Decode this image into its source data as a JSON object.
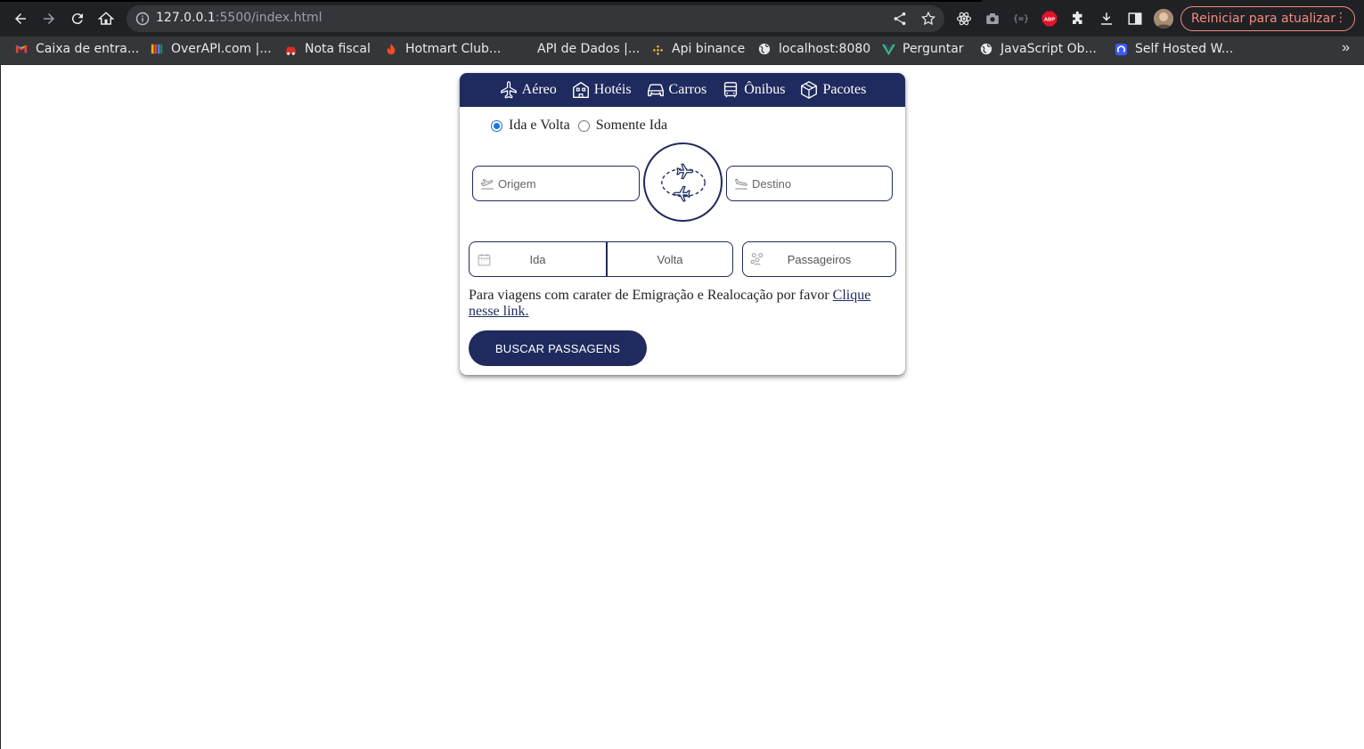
{
  "browser": {
    "url_host": "127.0.0.1",
    "url_path": ":5500/index.html",
    "update_button": "Reiniciar para atualizar",
    "bookmarks": [
      {
        "label": "Caixa de entra..."
      },
      {
        "label": "OverAPI.com |..."
      },
      {
        "label": "Nota fiscal"
      },
      {
        "label": "Hotmart Club..."
      },
      {
        "label": "API de Dados |..."
      },
      {
        "label": "Api binance"
      },
      {
        "label": "localhost:8080"
      },
      {
        "label": "Perguntar"
      },
      {
        "label": "JavaScript Ob..."
      },
      {
        "label": "Self Hosted W..."
      }
    ],
    "bookmarks_more": "»"
  },
  "nav": {
    "tabs": [
      {
        "label": "Aéreo",
        "icon": "plane-icon"
      },
      {
        "label": "Hotéis",
        "icon": "hotel-icon"
      },
      {
        "label": "Carros",
        "icon": "car-icon"
      },
      {
        "label": "Ônibus",
        "icon": "bus-icon"
      },
      {
        "label": "Pacotes",
        "icon": "package-icon"
      }
    ]
  },
  "trip_type": {
    "options": [
      "Ida e Volta",
      "Somente Ida"
    ],
    "selected": "Ida e Volta"
  },
  "fields": {
    "origin_placeholder": "Origem",
    "destination_placeholder": "Destino",
    "departure_placeholder": "Ida",
    "return_placeholder": "Volta",
    "passengers_placeholder": "Passageiros"
  },
  "notice": {
    "text": "Para viagens com carater de Emigração e Realocação por favor ",
    "link": "Clique nesse link."
  },
  "search_button": "BUSCAR PASSAGENS",
  "colors": {
    "brand_navy": "#1f2a5e",
    "chrome_dark": "#202124",
    "update_pill": "#f28b82",
    "radio_blue": "#1a73e8"
  }
}
